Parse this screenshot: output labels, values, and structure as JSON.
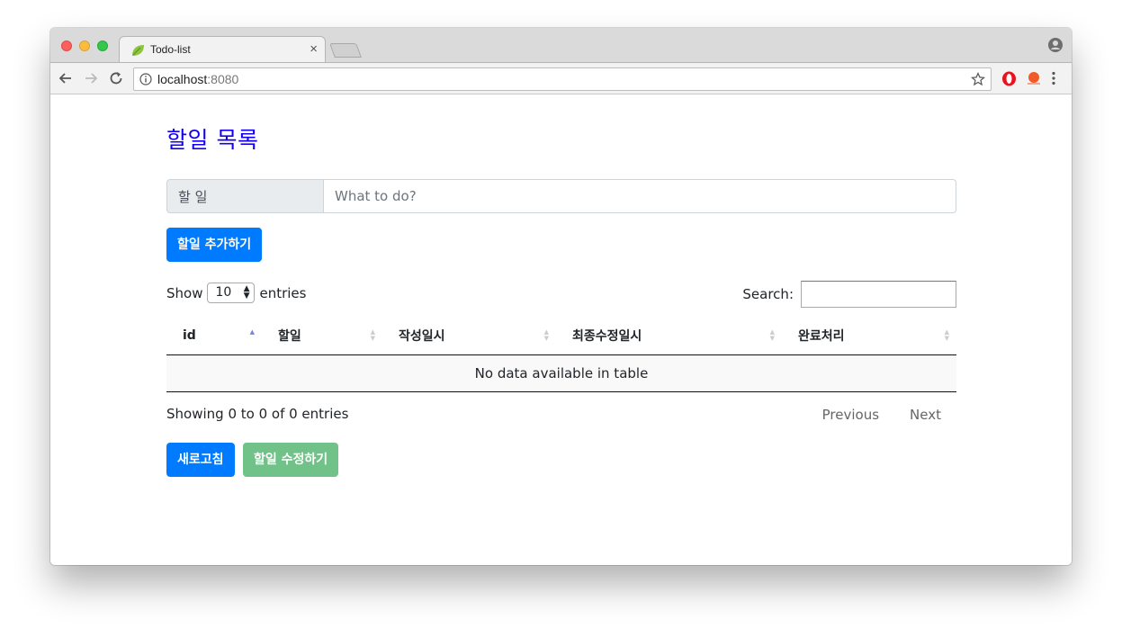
{
  "browser": {
    "tab_title": "Todo-list",
    "tab_close": "×",
    "url_host": "localhost",
    "url_port": ":8080"
  },
  "page": {
    "title": "할일 목록",
    "input_label": "할 일",
    "input_placeholder": "What to do?",
    "add_button": "할일 추가하기",
    "show_label": "Show",
    "entries_label": "entries",
    "page_length_value": "10",
    "search_label": "Search:",
    "columns": [
      "id",
      "할일",
      "작성일시",
      "최종수정일시",
      "완료처리"
    ],
    "empty_message": "No data available in table",
    "info": "Showing 0 to 0 of 0 entries",
    "pager": {
      "previous": "Previous",
      "next": "Next"
    },
    "refresh_button": "새로고침",
    "edit_button": "할일 수정하기"
  },
  "colors": {
    "title": "#1400f0",
    "primary": "#007bff",
    "success_disabled": "#71c288"
  }
}
